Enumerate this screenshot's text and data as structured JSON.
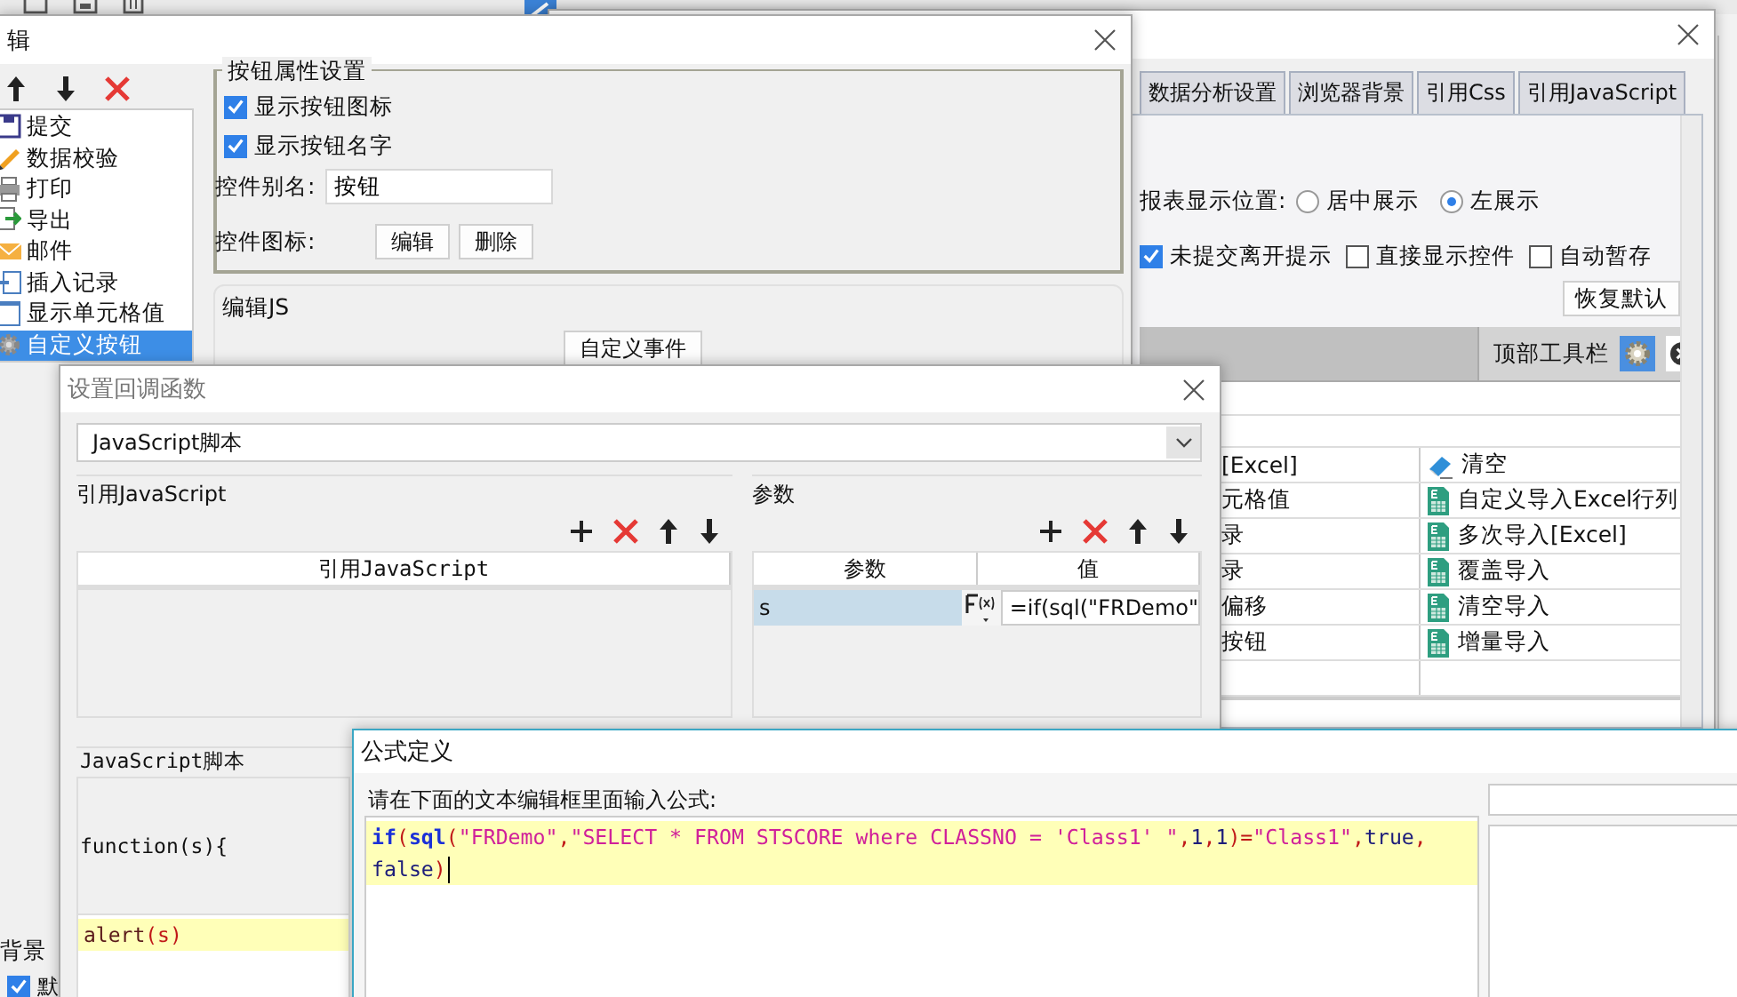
{
  "edit_window": {
    "title": "辑",
    "actions": [
      {
        "label": "提交",
        "selected": false
      },
      {
        "label": "数据校验",
        "selected": false
      },
      {
        "label": "打印",
        "selected": false
      },
      {
        "label": "导出",
        "selected": false
      },
      {
        "label": "邮件",
        "selected": false
      },
      {
        "label": "插入记录",
        "selected": false
      },
      {
        "label": "显示单元格值",
        "selected": false
      },
      {
        "label": "自定义按钮",
        "selected": true
      }
    ],
    "button_properties": {
      "title": "按钮属性设置",
      "options": [
        {
          "label": "显示按钮图标",
          "checked": true
        },
        {
          "label": "显示按钮名字",
          "checked": true
        }
      ],
      "alias_label": "控件别名:",
      "alias_value": "按钮",
      "icon_label": "控件图标:",
      "icon_buttons": [
        "编辑",
        "删除"
      ]
    },
    "js_panel": {
      "title": "编辑JS",
      "button": "自定义事件"
    },
    "background_label": "背景",
    "default_option": {
      "label": "默",
      "checked": true
    }
  },
  "report_window": {
    "tabs": [
      {
        "label": "数据分析设置",
        "selected": false
      },
      {
        "label": "浏览器背景",
        "selected": false
      },
      {
        "label": "引用Css",
        "selected": false
      },
      {
        "label": "引用JavaScript",
        "selected": false
      }
    ],
    "position_label": "报表显示位置:",
    "positions": [
      {
        "label": "居中展示",
        "selected": false
      },
      {
        "label": "左展示",
        "selected": true
      }
    ],
    "options": [
      {
        "label": "未提交离开提示",
        "checked": true
      },
      {
        "label": "直接显示控件",
        "checked": false
      },
      {
        "label": "自动暂存",
        "checked": false
      }
    ],
    "restore_button": "恢复默认",
    "toolbar_label": "顶部工具栏",
    "button_rows": [
      {
        "column_1": "[Excel]",
        "column_2": "清空"
      },
      {
        "column_1": "元格值",
        "column_2": "自定义导入Excel行列"
      },
      {
        "column_1": "录",
        "column_2": "多次导入[Excel]"
      },
      {
        "column_1": "录",
        "column_2": "覆盖导入"
      },
      {
        "column_1": "偏移",
        "column_2": "清空导入"
      },
      {
        "column_1": "按钮",
        "column_2": "增量导入"
      }
    ]
  },
  "callback_window": {
    "title": "设置回调函数",
    "type_select": "JavaScript脚本",
    "script_refs": {
      "title": "引用JavaScript",
      "columns": [
        "引用JavaScript"
      ]
    },
    "params": {
      "title": "参数",
      "columns": [
        "参数",
        "值"
      ],
      "rows": [
        {
          "name": "s",
          "value": "=if(sql(\"FRDemo\"",
          "selected": true
        }
      ]
    },
    "script_label": "JavaScript脚本",
    "function_header": "function(s){",
    "body_lines": [
      {
        "current": true,
        "tokens": [
          {
            "kind": "name",
            "text": "alert"
          },
          {
            "kind": "punct",
            "text": "(s)"
          }
        ]
      }
    ]
  },
  "formula_window": {
    "title": "公式定义",
    "prompt": "请在下面的文本编辑框里面输入公式:",
    "lines": [
      {
        "current": true,
        "tokens": [
          {
            "kind": "function",
            "text": "if"
          },
          {
            "kind": "punct",
            "text": "("
          },
          {
            "kind": "function",
            "text": "sql"
          },
          {
            "kind": "punct",
            "text": "("
          },
          {
            "kind": "string",
            "text": "\"FRDemo\""
          },
          {
            "kind": "punct",
            "text": ","
          },
          {
            "kind": "string",
            "text": "\"SELECT * FROM STSCORE where CLASSNO = 'Class1' \""
          },
          {
            "kind": "punct",
            "text": ","
          },
          {
            "kind": "literal",
            "text": "1"
          },
          {
            "kind": "punct",
            "text": ","
          },
          {
            "kind": "literal",
            "text": "1"
          },
          {
            "kind": "punct",
            "text": ")="
          },
          {
            "kind": "string",
            "text": "\"Class1\""
          },
          {
            "kind": "punct",
            "text": ","
          },
          {
            "kind": "literal",
            "text": "true"
          },
          {
            "kind": "punct",
            "text": ","
          }
        ]
      },
      {
        "current": true,
        "tokens": [
          {
            "kind": "literal",
            "text": "false"
          },
          {
            "kind": "punct",
            "text": ")"
          }
        ]
      }
    ]
  }
}
